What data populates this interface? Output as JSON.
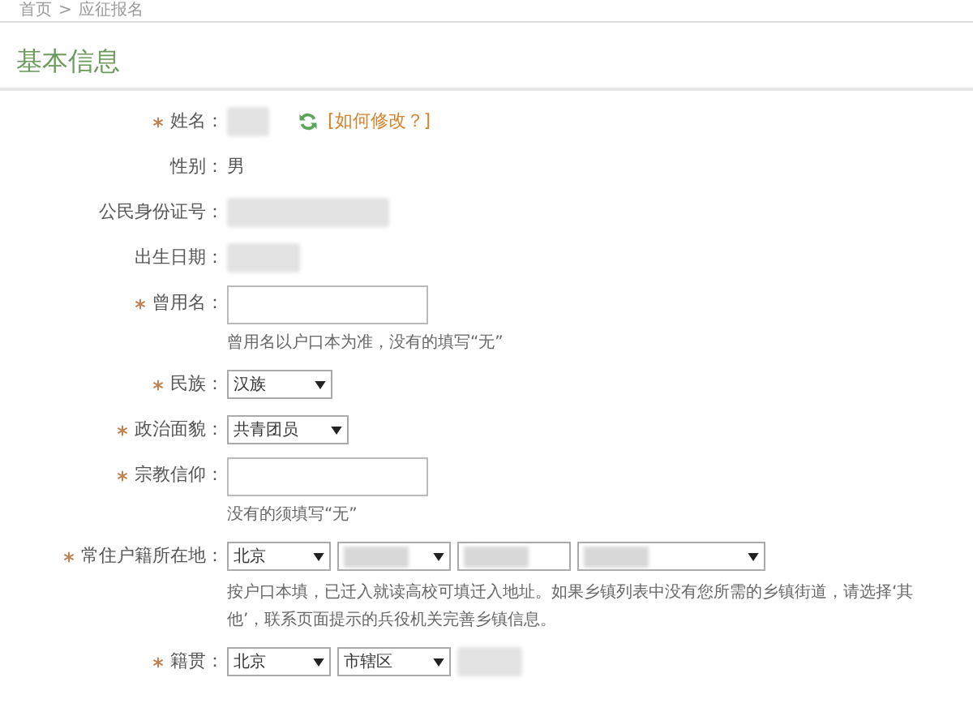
{
  "breadcrumb": {
    "items": [
      "首页",
      "应征报名"
    ],
    "separator": ">"
  },
  "section_title": "基本信息",
  "fields": [
    {
      "label": "姓名：",
      "required": true,
      "kind": "redacted",
      "action": "[如何修改？]"
    },
    {
      "label": "性别：",
      "required": false,
      "kind": "text",
      "value": "男"
    },
    {
      "label": "公民身份证号：",
      "required": false,
      "kind": "redacted"
    },
    {
      "label": "出生日期：",
      "required": false,
      "kind": "redacted"
    },
    {
      "label": "曾用名：",
      "required": true,
      "kind": "input",
      "hint": "曾用名以户口本为准，没有的填写“无”"
    },
    {
      "label": "民族：",
      "required": true,
      "kind": "selects",
      "selects": [
        {
          "value": "汉族"
        }
      ]
    },
    {
      "label": "政治面貌：",
      "required": true,
      "kind": "selects",
      "selects": [
        {
          "value": "共青团员"
        }
      ]
    },
    {
      "label": "宗教信仰：",
      "required": true,
      "kind": "input",
      "hint": "没有的须填写“无”"
    },
    {
      "label": "常住户籍所在地：",
      "required": true,
      "kind": "selects",
      "selects": [
        {
          "value": "北京"
        },
        {
          "redacted": true
        },
        {
          "redacted": true,
          "arrow": false
        },
        {
          "redacted": true
        }
      ],
      "hint": "按户口本填，已迁入就读高校可填迁入地址。如果乡镇列表中没有您所需的乡镇街道，请选择‘其他’，联系页面提示的兵役机关完善乡镇信息。"
    },
    {
      "label": "籍贯：",
      "required": true,
      "kind": "selects",
      "selects": [
        {
          "value": "北京"
        },
        {
          "value": "市辖区"
        }
      ],
      "trailing_redacted": true
    }
  ]
}
